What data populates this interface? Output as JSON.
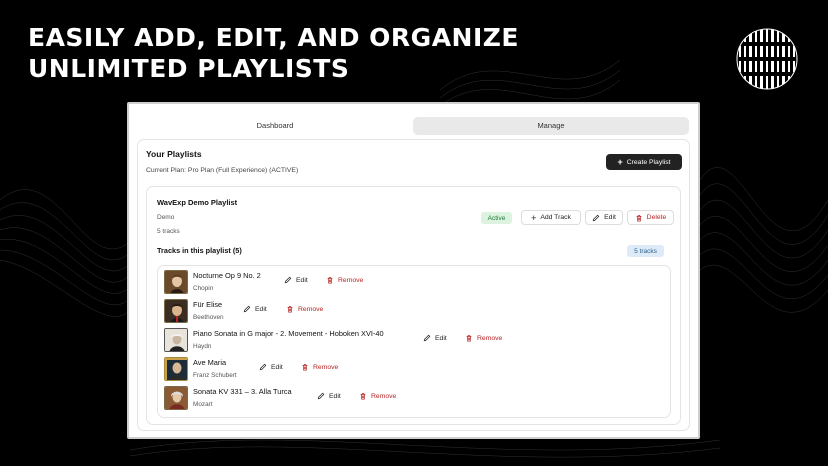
{
  "headline": {
    "line1": "EASILY ADD, EDIT, AND ORGANIZE",
    "line2": "UNLIMITED PLAYLISTS"
  },
  "tabs": [
    {
      "label": "Dashboard",
      "active": false
    },
    {
      "label": "Manage",
      "active": true
    }
  ],
  "panel": {
    "title": "Your Playlists",
    "plan": "Current Plan: Pro Plan (Full Experience) (ACTIVE)",
    "create_button": "Create Playlist"
  },
  "playlist": {
    "name": "WavExp Demo Playlist",
    "description": "Demo",
    "count": "5 tracks",
    "status": "Active",
    "add_track": "Add Track",
    "edit": "Edit",
    "delete": "Delete",
    "tracks_title": "Tracks in this playlist (5)",
    "tracks_badge": "5 tracks"
  },
  "tracks": [
    {
      "title": "Nocturne Op 9 No. 2",
      "artist": "Chopin",
      "edit": "Edit",
      "remove": "Remove"
    },
    {
      "title": "Für Elise",
      "artist": "Beethoven",
      "edit": "Edit",
      "remove": "Remove"
    },
    {
      "title": "Piano Sonata in G major - 2. Movement - Hoboken XVI-40",
      "artist": "Haydn",
      "edit": "Edit",
      "remove": "Remove"
    },
    {
      "title": "Ave Maria",
      "artist": "Franz Schubert",
      "edit": "Edit",
      "remove": "Remove"
    },
    {
      "title": "Sonata KV 331 – 3. Alla Turca",
      "artist": "Mozart",
      "edit": "Edit",
      "remove": "Remove"
    }
  ],
  "colors": {
    "background": "#000000",
    "primary_button": "#222222",
    "danger": "#b72424",
    "active_badge_bg": "#dcf3df",
    "active_badge_text": "#1c7a35",
    "count_badge_bg": "#dcebf7"
  }
}
